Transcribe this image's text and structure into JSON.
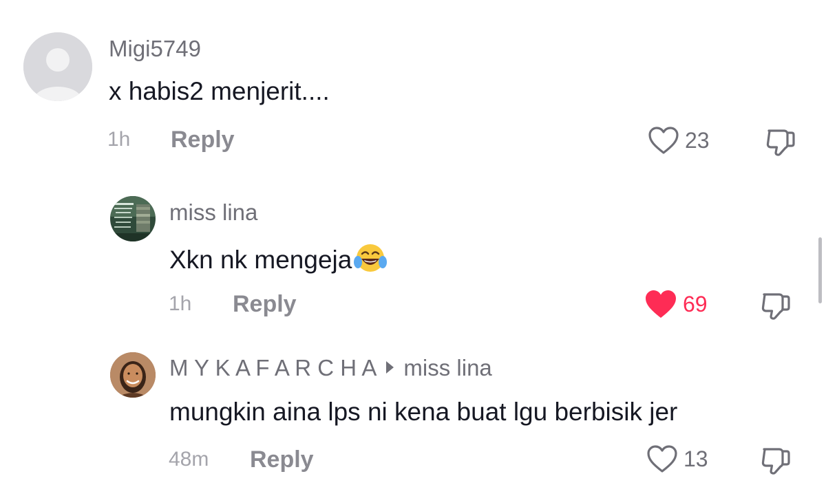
{
  "comments": [
    {
      "username": "Migi5749",
      "text": "x habis2 menjerit....",
      "time": "1h",
      "reply_label": "Reply",
      "likes": "23",
      "liked": false
    },
    {
      "username": "miss lina",
      "text": "Xkn nk mengeja",
      "emoji": "face-with-tears-of-joy",
      "time": "1h",
      "reply_label": "Reply",
      "likes": "69",
      "liked": true
    },
    {
      "username": "M Y K A F A R C H A",
      "reply_to": "miss lina",
      "text": "mungkin aina lps ni kena buat lgu berbisik jer",
      "time": "48m",
      "reply_label": "Reply",
      "likes": "13",
      "liked": false
    }
  ],
  "colors": {
    "liked": "#fe2c55",
    "secondary_text": "#6f6f77",
    "primary_text": "#161823"
  }
}
